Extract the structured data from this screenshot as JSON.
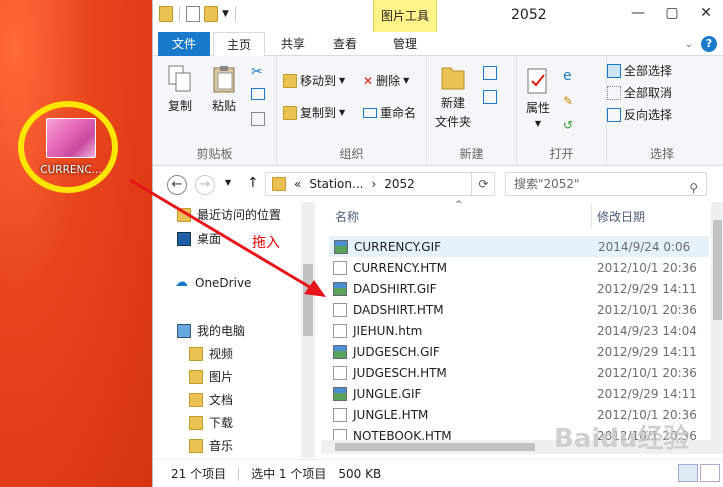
{
  "desktop": {
    "icon_label": "CURRENC..."
  },
  "titlebar": {
    "context_tab": "图片工具",
    "title": "2052",
    "minimize": "—",
    "maximize": "▢",
    "close": "✕"
  },
  "tabs": {
    "file": "文件",
    "home": "主页",
    "share": "共享",
    "view": "查看",
    "manage": "管理"
  },
  "ribbon": {
    "clipboard": {
      "copy": "复制",
      "paste": "粘贴",
      "label": "剪贴板"
    },
    "organize": {
      "move_to": "移动到",
      "copy_to": "复制到",
      "delete": "删除",
      "rename": "重命名",
      "label": "组织"
    },
    "new": {
      "new_folder_line1": "新建",
      "new_folder_line2": "文件夹",
      "label": "新建"
    },
    "open": {
      "properties": "属性",
      "label": "打开"
    },
    "select": {
      "select_all": "全部选择",
      "select_none": "全部取消",
      "invert": "反向选择",
      "label": "选择"
    }
  },
  "address": {
    "sep": "«",
    "crumb1": "Station...",
    "crumb_sep": "›",
    "crumb2": "2052",
    "search_placeholder": "搜索\"2052\""
  },
  "navpane": {
    "recent": "最近访问的位置",
    "desktop": "桌面",
    "onedrive": "OneDrive",
    "mypc": "我的电脑",
    "videos": "视频",
    "pictures": "图片",
    "documents": "文档",
    "downloads": "下载",
    "music": "音乐"
  },
  "filelist": {
    "col_name": "名称",
    "col_date": "修改日期",
    "files": [
      {
        "name": "CURRENCY.GIF",
        "date": "2014/9/24 0:06",
        "type": "gif"
      },
      {
        "name": "CURRENCY.HTM",
        "date": "2012/10/1 20:36",
        "type": "htm"
      },
      {
        "name": "DADSHIRT.GIF",
        "date": "2012/9/29 14:11",
        "type": "gif"
      },
      {
        "name": "DADSHIRT.HTM",
        "date": "2012/10/1 20:36",
        "type": "htm"
      },
      {
        "name": "JIEHUN.htm",
        "date": "2014/9/23 14:04",
        "type": "htm"
      },
      {
        "name": "JUDGESCH.GIF",
        "date": "2012/9/29 14:11",
        "type": "gif"
      },
      {
        "name": "JUDGESCH.HTM",
        "date": "2012/10/1 20:36",
        "type": "htm"
      },
      {
        "name": "JUNGLE.GIF",
        "date": "2012/9/29 14:11",
        "type": "gif"
      },
      {
        "name": "JUNGLE.HTM",
        "date": "2012/10/1 20:36",
        "type": "htm"
      },
      {
        "name": "NOTEBOOK.HTM",
        "date": "2012/10/1 20:36",
        "type": "htm"
      }
    ]
  },
  "statusbar": {
    "count": "21 个项目",
    "selected": "选中 1 个项目",
    "size": "500 KB"
  },
  "overlay": {
    "drag_label": "拖入",
    "watermark": "Baidu经验",
    "highlight_color": "#ffe600",
    "arrow_color": "#e8131b"
  },
  "colors": {
    "accent": "#1979ca",
    "context_tab": "#fff38a",
    "desktop": "#e8441c"
  }
}
